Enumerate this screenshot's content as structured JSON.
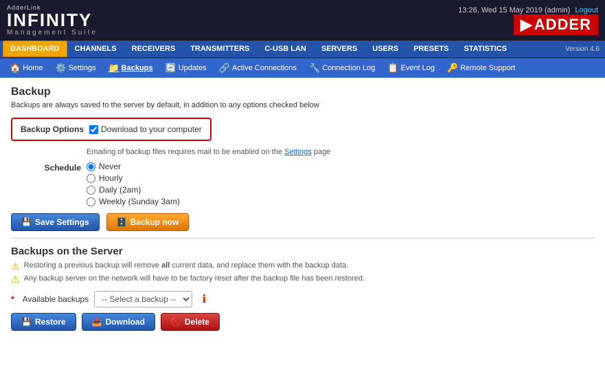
{
  "header": {
    "adderlink": "AdderLink",
    "infinity": "INFINITY",
    "mgmt": "Management Suite",
    "time": "13:26, Wed 15 May 2019",
    "user": "(admin)",
    "logout": "Logout",
    "adder_brand": "▶ADDER",
    "version": "Version 4.6"
  },
  "nav": {
    "tabs": [
      {
        "label": "DASHBOARD",
        "active": false
      },
      {
        "label": "CHANNELS",
        "active": false
      },
      {
        "label": "RECEIVERS",
        "active": false
      },
      {
        "label": "TRANSMITTERS",
        "active": false
      },
      {
        "label": "C-USB LAN",
        "active": false
      },
      {
        "label": "SERVERS",
        "active": false
      },
      {
        "label": "USERS",
        "active": false
      },
      {
        "label": "PRESETS",
        "active": false
      },
      {
        "label": "STATISTICS",
        "active": false
      }
    ]
  },
  "subnav": {
    "items": [
      {
        "label": "Home",
        "icon": "🏠",
        "active": false
      },
      {
        "label": "Settings",
        "icon": "⚙️",
        "active": false
      },
      {
        "label": "Backups",
        "icon": "📁",
        "active": true
      },
      {
        "label": "Updates",
        "icon": "🔄",
        "active": false
      },
      {
        "label": "Active Connections",
        "icon": "🔗",
        "active": false
      },
      {
        "label": "Connection Log",
        "icon": "🔧",
        "active": false
      },
      {
        "label": "Event Log",
        "icon": "📋",
        "active": false
      },
      {
        "label": "Remote Support",
        "icon": "🔑",
        "active": false
      }
    ]
  },
  "page": {
    "title": "Backup",
    "description": "Backups are always saved to the server by default, in addition to any options checked below",
    "backup_options_label": "Backup Options",
    "download_label": "Download to your computer",
    "email_note_before": "Emailing of backup files requires mail to be enabled on the",
    "settings_link": "Settings",
    "email_note_after": "page",
    "schedule_label": "Schedule",
    "schedule_options": [
      {
        "label": "Never",
        "value": "never",
        "checked": true
      },
      {
        "label": "Hourly",
        "value": "hourly",
        "checked": false
      },
      {
        "label": "Daily (2am)",
        "value": "daily",
        "checked": false
      },
      {
        "label": "Weekly (Sunday 3am)",
        "value": "weekly",
        "checked": false
      }
    ],
    "save_settings_label": "Save Settings",
    "backup_now_label": "Backup now",
    "server_section_title": "Backups on the Server",
    "warning1_pre": "Restoring a previous backup will remove",
    "warning1_bold": "all",
    "warning1_post": "current data, and replace them with the backup data.",
    "warning2": "Any backup server on the network will have to be factory reset after the backup file has been restored.",
    "available_backups_star": "*",
    "available_backups_label": "Available backups",
    "select_placeholder": "-- Select a backup --",
    "restore_label": "Restore",
    "download_btn_label": "Download",
    "delete_label": "Delete"
  }
}
